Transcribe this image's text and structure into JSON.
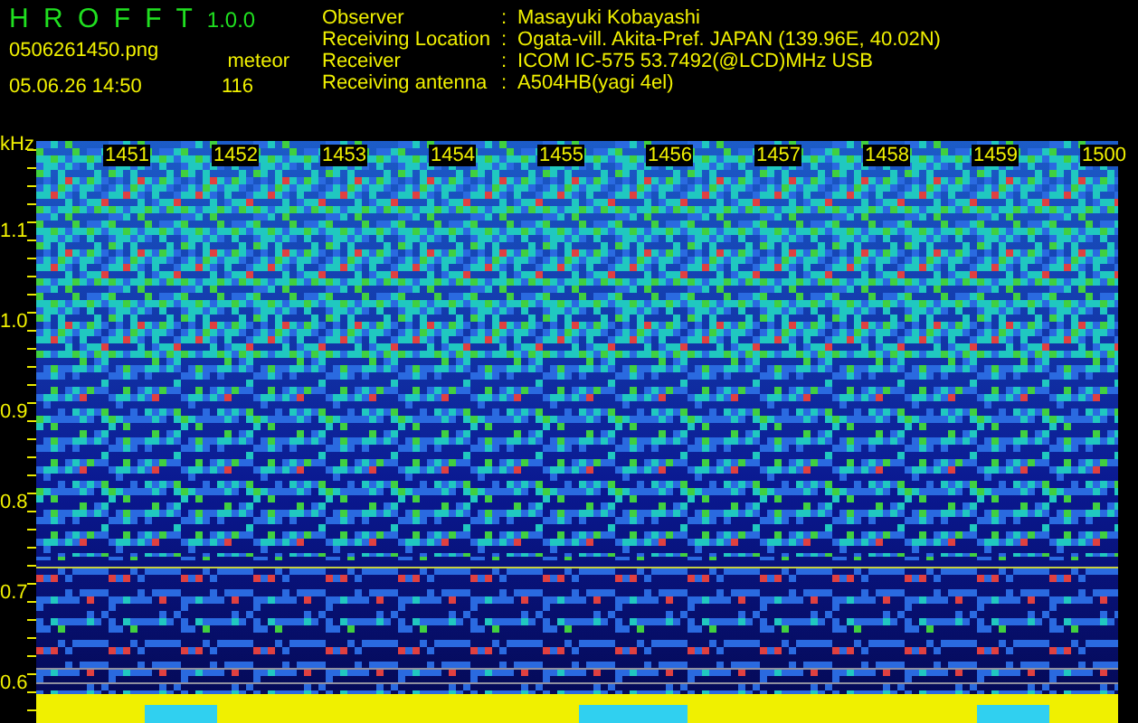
{
  "app": {
    "name": "H R O F F T",
    "version": "1.0.0"
  },
  "file": "0506261450.png",
  "datetime": "05.06.26 14:50",
  "counter": {
    "label": "meteor",
    "value": "116"
  },
  "info": [
    {
      "label": "Observer",
      "separator": ":",
      "value": "Masayuki Kobayashi"
    },
    {
      "label": "Receiving Location",
      "separator": ":",
      "value": "Ogata-vill. Akita-Pref. JAPAN (139.96E, 40.02N)"
    },
    {
      "label": "Receiver",
      "separator": ":",
      "value": "ICOM IC-575 53.7492(@LCD)MHz USB"
    },
    {
      "label": "Receiving antenna",
      "separator": ":",
      "value": "A504HB(yagi 4el)"
    }
  ],
  "spectrogram": {
    "unit": "kHz",
    "time_labels": [
      "1451",
      "1452",
      "1453",
      "1454",
      "1455",
      "1456",
      "1457",
      "1458",
      "1459",
      "1500"
    ],
    "frequency_labels": [
      "1.1",
      "1.0",
      "0.9",
      "0.8",
      "0.7",
      "0.6"
    ]
  }
}
